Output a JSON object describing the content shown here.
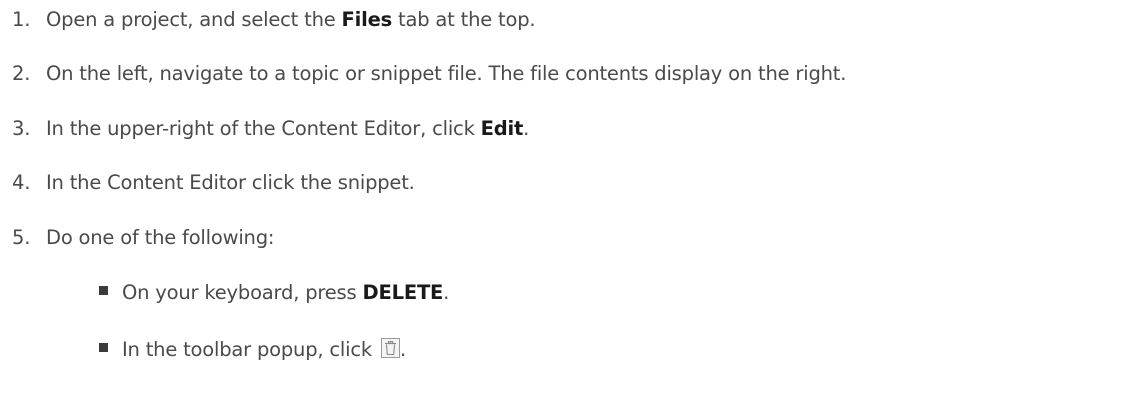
{
  "steps": [
    {
      "number": "1.",
      "pre": "Open a project, and select the ",
      "strong": "Files",
      "post": " tab at the top."
    },
    {
      "number": "2.",
      "text": "On the left, navigate to a topic or snippet file. The file contents display on the right."
    },
    {
      "number": "3.",
      "pre": "In the upper-right of the Content Editor, click ",
      "strong": "Edit",
      "post": "."
    },
    {
      "number": "4.",
      "text": "In the Content Editor click the snippet."
    },
    {
      "number": "5.",
      "text": "Do one of the following:"
    }
  ],
  "options": [
    {
      "pre": "On your keyboard, press ",
      "strong": "DELETE",
      "post": "."
    },
    {
      "pre": "In the toolbar popup, click ",
      "icon": "trash-icon",
      "post": "."
    }
  ]
}
